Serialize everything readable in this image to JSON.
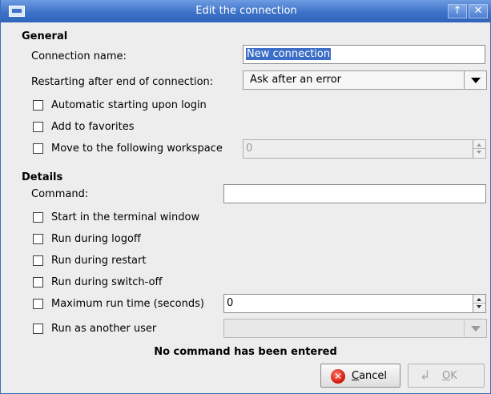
{
  "window": {
    "title": "Edit the connection",
    "up_glyph": "↑",
    "close_glyph": "✕"
  },
  "general": {
    "heading": "General",
    "connection_name_label": "Connection name:",
    "connection_name_value": "New connection",
    "restart_label": "Restarting after end of connection:",
    "restart_value": "Ask after an error",
    "auto_start_label": "Automatic starting upon login",
    "favorites_label": "Add to favorites",
    "workspace_label": "Move to the following workspace",
    "workspace_value": "0"
  },
  "details": {
    "heading": "Details",
    "command_label": "Command:",
    "command_value": "",
    "terminal_label": "Start in the terminal window",
    "logoff_label": "Run during logoff",
    "restart_label": "Run during restart",
    "switchoff_label": "Run during switch-off",
    "max_run_label": "Maximum run time (seconds)",
    "max_run_value": "0",
    "another_user_label": "Run as another user",
    "another_user_value": ""
  },
  "status": "No command has been entered",
  "buttons": {
    "cancel_first": "C",
    "cancel_rest": "ancel",
    "ok_first": "O",
    "ok_rest": "K"
  },
  "icons": {
    "cancel": "cancel-icon",
    "ok": "ok-arrow-icon",
    "window": "window-app-icon"
  },
  "colors": {
    "titlebar": "#3e73c9",
    "selection": "#3d6ec7",
    "background": "#ededed"
  }
}
